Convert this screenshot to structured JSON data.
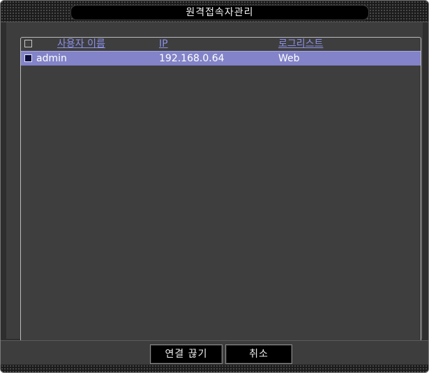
{
  "window": {
    "title": "원격접속자관리"
  },
  "list": {
    "columns": {
      "user": "사용자 이름",
      "ip": "IP",
      "login_type": "로그리스트"
    },
    "rows": [
      {
        "user": "admin",
        "ip": "192.168.0.64",
        "login_type": "Web",
        "selected": true
      }
    ]
  },
  "footer": {
    "disconnect_label": "연결 끊기",
    "cancel_label": "취소"
  },
  "colors": {
    "header_text": "#8c90e8",
    "selected_row": "#8283c8",
    "panel_bg": "#3d3d3d"
  }
}
